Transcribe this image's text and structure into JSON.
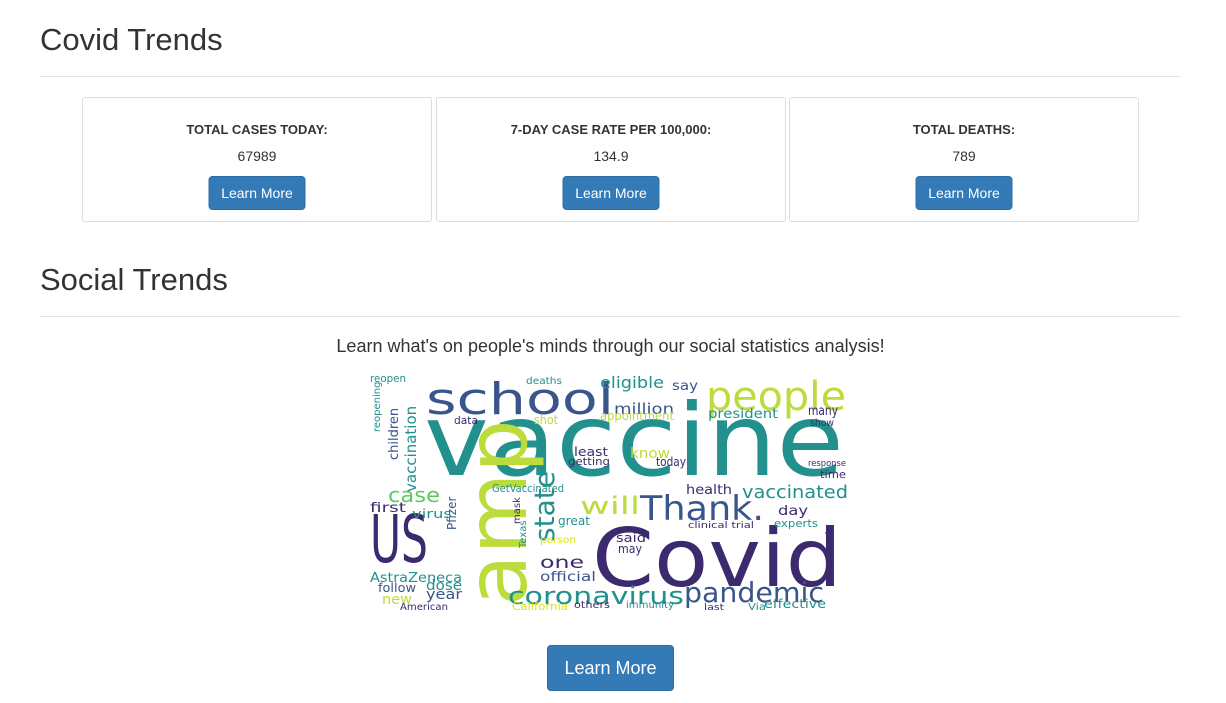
{
  "covid": {
    "title": "Covid Trends",
    "cards": [
      {
        "label": "TOTAL CASES TODAY:",
        "value": "67989",
        "button": "Learn More"
      },
      {
        "label": "7-DAY CASE RATE PER 100,000:",
        "value": "134.9",
        "button": "Learn More"
      },
      {
        "label": "TOTAL DEATHS:",
        "value": "789",
        "button": "Learn More"
      }
    ]
  },
  "social": {
    "title": "Social Trends",
    "tagline": "Learn what's on people's minds through our social statistics analysis!",
    "button": "Learn More",
    "wordcloud": {
      "palette": {
        "purple": "#3b2a6e",
        "teal": "#22908c",
        "lime": "#bcdc3c",
        "blue": "#39558c",
        "green": "#5ec962",
        "yellow": "#dde318"
      },
      "words": [
        {
          "text": "vaccine",
          "color": "teal"
        },
        {
          "text": "Covid",
          "color": "purple"
        },
        {
          "text": "amp",
          "color": "lime"
        },
        {
          "text": "school",
          "color": "blue"
        },
        {
          "text": "people",
          "color": "lime"
        },
        {
          "text": "US",
          "color": "purple"
        },
        {
          "text": "Thank.",
          "color": "blue"
        },
        {
          "text": "state",
          "color": "teal"
        },
        {
          "text": "pandemic",
          "color": "blue"
        },
        {
          "text": "coronavirus",
          "color": "teal"
        },
        {
          "text": "vaccinated",
          "color": "teal"
        },
        {
          "text": "will",
          "color": "lime"
        },
        {
          "text": "case",
          "color": "green"
        },
        {
          "text": "eligible",
          "color": "teal"
        },
        {
          "text": "vaccination",
          "color": "teal"
        },
        {
          "text": "children",
          "color": "blue"
        },
        {
          "text": "AstraZeneca",
          "color": "teal"
        },
        {
          "text": "million",
          "color": "blue"
        },
        {
          "text": "president",
          "color": "teal"
        },
        {
          "text": "appointment",
          "color": "lime"
        },
        {
          "text": "one",
          "color": "purple"
        },
        {
          "text": "official",
          "color": "blue"
        },
        {
          "text": "effective",
          "color": "teal"
        },
        {
          "text": "know",
          "color": "lime"
        },
        {
          "text": "health",
          "color": "purple"
        },
        {
          "text": "first",
          "color": "purple"
        },
        {
          "text": "year",
          "color": "blue"
        },
        {
          "text": "new",
          "color": "lime"
        },
        {
          "text": "dose",
          "color": "teal"
        },
        {
          "text": "day",
          "color": "purple"
        },
        {
          "text": "say",
          "color": "blue"
        },
        {
          "text": "many",
          "color": "purple"
        },
        {
          "text": "Pfizer",
          "color": "blue"
        },
        {
          "text": "virus",
          "color": "teal"
        },
        {
          "text": "follow",
          "color": "blue"
        },
        {
          "text": "today",
          "color": "purple"
        },
        {
          "text": "great",
          "color": "teal"
        },
        {
          "text": "said",
          "color": "purple"
        },
        {
          "text": "may",
          "color": "purple"
        },
        {
          "text": "experts",
          "color": "teal"
        },
        {
          "text": "time",
          "color": "purple"
        },
        {
          "text": "important",
          "color": "purple"
        },
        {
          "text": "show",
          "color": "purple"
        },
        {
          "text": "reopen",
          "color": "teal"
        },
        {
          "text": "deaths",
          "color": "teal"
        },
        {
          "text": "least",
          "color": "purple"
        },
        {
          "text": "getting",
          "color": "purple"
        },
        {
          "text": "American",
          "color": "purple"
        },
        {
          "text": "California",
          "color": "yellow"
        },
        {
          "text": "others",
          "color": "purple"
        },
        {
          "text": "immunity",
          "color": "teal"
        },
        {
          "text": "GetVaccinated",
          "color": "teal"
        },
        {
          "text": "reopening",
          "color": "teal"
        },
        {
          "text": "shot",
          "color": "lime"
        },
        {
          "text": "data",
          "color": "purple"
        },
        {
          "text": "Texas",
          "color": "teal"
        },
        {
          "text": "person",
          "color": "yellow"
        },
        {
          "text": "mask",
          "color": "purple"
        },
        {
          "text": "Via",
          "color": "teal"
        },
        {
          "text": "last",
          "color": "purple"
        },
        {
          "text": "clinical trial",
          "color": "purple"
        },
        {
          "text": "response",
          "color": "purple"
        }
      ]
    }
  }
}
